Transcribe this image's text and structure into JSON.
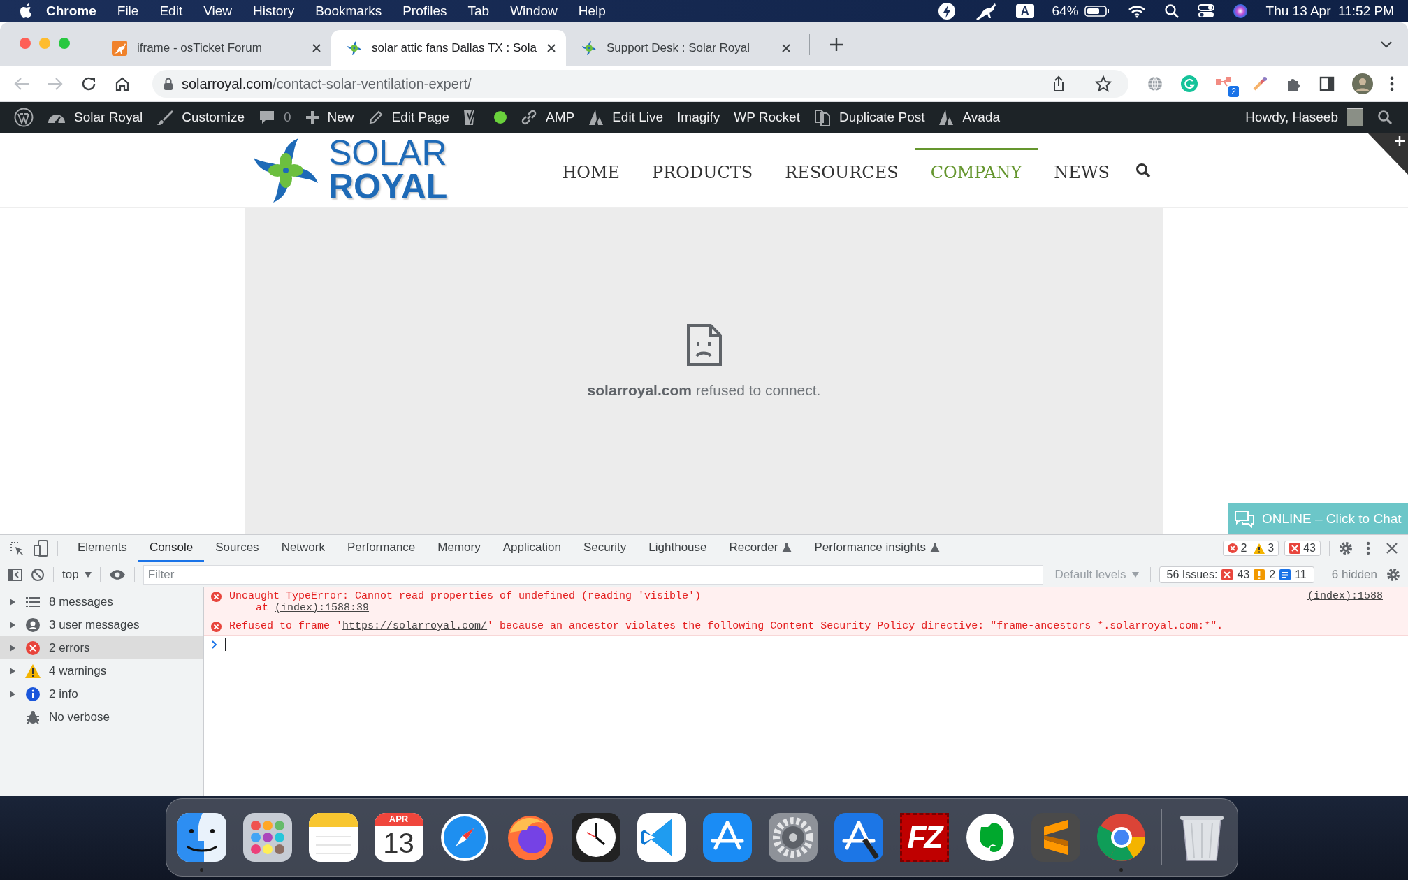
{
  "menu_bar": {
    "app": "Chrome",
    "menus": [
      "File",
      "Edit",
      "View",
      "History",
      "Bookmarks",
      "Profiles",
      "Tab",
      "Window",
      "Help"
    ],
    "input_source": "A",
    "battery": "64%",
    "clock": "Thu 13 Apr  11:52 PM"
  },
  "tabs": [
    {
      "title": "iframe - osTicket Forum",
      "kind": "kangaroo",
      "selected": false
    },
    {
      "title": "solar attic fans Dallas TX : Sola",
      "kind": "pinwheel",
      "selected": true
    },
    {
      "title": "Support Desk : Solar Royal",
      "kind": "pinwheel",
      "selected": false
    }
  ],
  "address_bar": {
    "domain": "solarroyal.com",
    "path": "/contact-solar-ventilation-expert/"
  },
  "extensions": [
    {
      "kind": "globe"
    },
    {
      "kind": "grammarly"
    },
    {
      "kind": "flow",
      "badge": "2"
    },
    {
      "kind": "picker"
    },
    {
      "kind": "puzzle"
    },
    {
      "kind": "sidepanel"
    },
    {
      "kind": "avatar"
    }
  ],
  "wp_admin_bar": {
    "items": [
      {
        "kind": "wp-logo"
      },
      {
        "kind": "dashboard",
        "label": "Solar Royal"
      },
      {
        "kind": "brush",
        "label": "Customize"
      },
      {
        "kind": "comments",
        "label": "0"
      },
      {
        "kind": "plus",
        "label": "New"
      },
      {
        "kind": "pencil",
        "label": "Edit Page"
      },
      {
        "kind": "yoast"
      },
      {
        "kind": "status",
        "color": "#6ad13c"
      },
      {
        "kind": "link",
        "label": "AMP"
      },
      {
        "kind": "avada",
        "label": "Edit Live"
      },
      {
        "kind": "text",
        "label": "Imagify"
      },
      {
        "kind": "text",
        "label": "WP Rocket"
      },
      {
        "kind": "copy",
        "label": "Duplicate Post"
      },
      {
        "kind": "avada",
        "label": "Avada"
      }
    ],
    "greeting": "Howdy, Haseeb"
  },
  "site": {
    "logo": {
      "line_1": "SOLAR",
      "line_2": "ROYAL"
    },
    "nav": [
      {
        "label": "HOME",
        "selected": false
      },
      {
        "label": "PRODUCTS",
        "selected": false
      },
      {
        "label": "RESOURCES",
        "selected": false
      },
      {
        "label": "COMPANY",
        "selected": true
      },
      {
        "label": "NEWS",
        "selected": false
      }
    ]
  },
  "frame_error": "**solarroyal.com** refused to connect.",
  "chat_button": "ONLINE – Click to Chat",
  "devtools": {
    "tabs": [
      {
        "label": "Elements",
        "selected": false,
        "experimental": false
      },
      {
        "label": "Console",
        "selected": true,
        "experimental": false
      },
      {
        "label": "Sources",
        "selected": false,
        "experimental": false
      },
      {
        "label": "Network",
        "selected": false,
        "experimental": false
      },
      {
        "label": "Performance",
        "selected": false,
        "experimental": false
      },
      {
        "label": "Memory",
        "selected": false,
        "experimental": false
      },
      {
        "label": "Application",
        "selected": false,
        "experimental": false
      },
      {
        "label": "Security",
        "selected": false,
        "experimental": false
      },
      {
        "label": "Lighthouse",
        "selected": false,
        "experimental": false
      },
      {
        "label": "Recorder",
        "selected": false,
        "experimental": true
      },
      {
        "label": "Performance insights",
        "selected": false,
        "experimental": true
      }
    ],
    "error_count": "2",
    "warning_count": "3",
    "issue_count": "43",
    "console_toolbar": {
      "context": "top",
      "filter_placeholder": "Filter",
      "levels": "Default levels",
      "issues_label": "56 Issues:",
      "issues_errors": "43",
      "issues_warnings": "2",
      "issues_info": "11",
      "hidden": "6 hidden"
    },
    "sidebar": [
      {
        "kind": "messages",
        "label": "8 messages",
        "selected": false
      },
      {
        "kind": "user",
        "label": "3 user messages",
        "selected": false
      },
      {
        "kind": "error",
        "label": "2 errors",
        "selected": true
      },
      {
        "kind": "warning",
        "label": "4 warnings",
        "selected": false
      },
      {
        "kind": "info",
        "label": "2 info",
        "selected": false
      },
      {
        "kind": "verbose",
        "label": "No verbose",
        "selected": false
      }
    ],
    "messages": [
      {
        "kind": "error",
        "text": "Uncaught TypeError: Cannot read properties of undefined (reading 'visible')",
        "stack_prefix": "at ",
        "stack_link": "(index):1588:39",
        "source": "(index):1588"
      },
      {
        "kind": "error",
        "text_before": "Refused to frame '",
        "link": "https://solarroyal.com/",
        "text_after": "' because an ancestor violates the following Content Security Policy directive: \"frame-ancestors *.solarroyal.com:*\"."
      }
    ]
  },
  "dock": [
    {
      "kind": "finder",
      "running": true
    },
    {
      "kind": "launchpad",
      "running": false
    },
    {
      "kind": "notes",
      "running": false
    },
    {
      "kind": "calendar",
      "month": "APR",
      "day": "13",
      "running": false
    },
    {
      "kind": "safari",
      "running": false
    },
    {
      "kind": "firefox",
      "running": false
    },
    {
      "kind": "clock",
      "running": false
    },
    {
      "kind": "vscode",
      "running": false
    },
    {
      "kind": "appstore",
      "running": false
    },
    {
      "kind": "settings",
      "running": false
    },
    {
      "kind": "xcode",
      "running": false
    },
    {
      "kind": "filezilla",
      "label": "FZ",
      "running": false
    },
    {
      "kind": "evernote",
      "running": false
    },
    {
      "kind": "sublime",
      "running": false
    },
    {
      "kind": "chrome",
      "running": true
    },
    {
      "kind": "trash",
      "running": false
    }
  ]
}
